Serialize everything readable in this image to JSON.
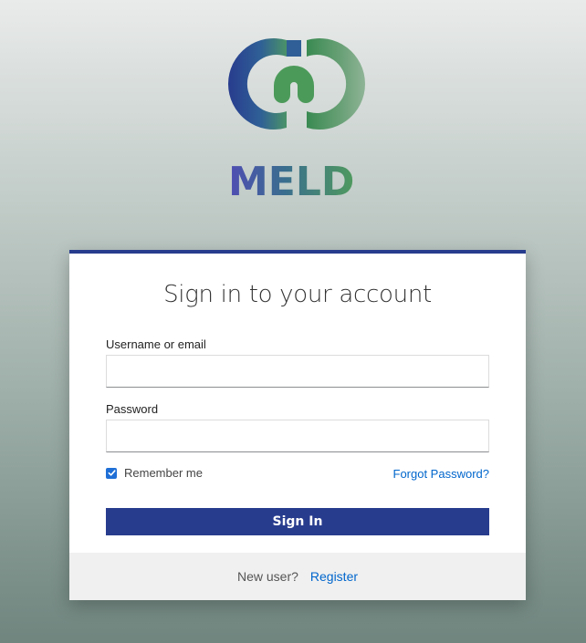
{
  "brand": {
    "name": "MELD",
    "colors": {
      "primary": "#283c8e",
      "green": "#4f9a5e",
      "blue": "#2e4fa3",
      "teal": "#3b7f86",
      "link": "#0066cc"
    }
  },
  "login": {
    "title": "Sign in to your account",
    "username_label": "Username or email",
    "username_value": "",
    "password_label": "Password",
    "password_value": "",
    "remember_label": "Remember me",
    "remember_checked": true,
    "forgot_link": "Forgot Password?",
    "sign_in_label": "Sign In"
  },
  "footer": {
    "new_user_text": "New user?",
    "register_link": "Register"
  },
  "icons": {
    "logo": "meld-logo-icon",
    "checkbox": "checkmark-icon"
  }
}
